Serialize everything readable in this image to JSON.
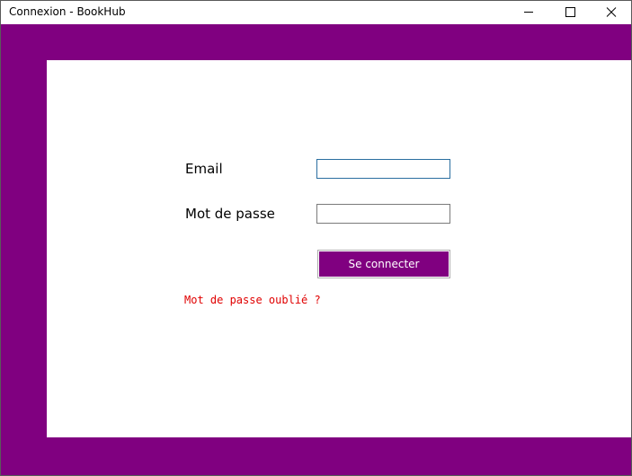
{
  "window": {
    "title": "Connexion - BookHub",
    "controls": {
      "minimize": "minimize-icon",
      "maximize": "maximize-icon",
      "close": "close-icon"
    }
  },
  "form": {
    "email_label": "Email",
    "email_value": "",
    "password_label": "Mot de passe",
    "password_value": "",
    "login_button": "Se connecter",
    "forgot_link": "Mot de passe oublié ?"
  },
  "colors": {
    "accent": "#800080",
    "link": "#e00000",
    "panel": "#ffffff"
  }
}
